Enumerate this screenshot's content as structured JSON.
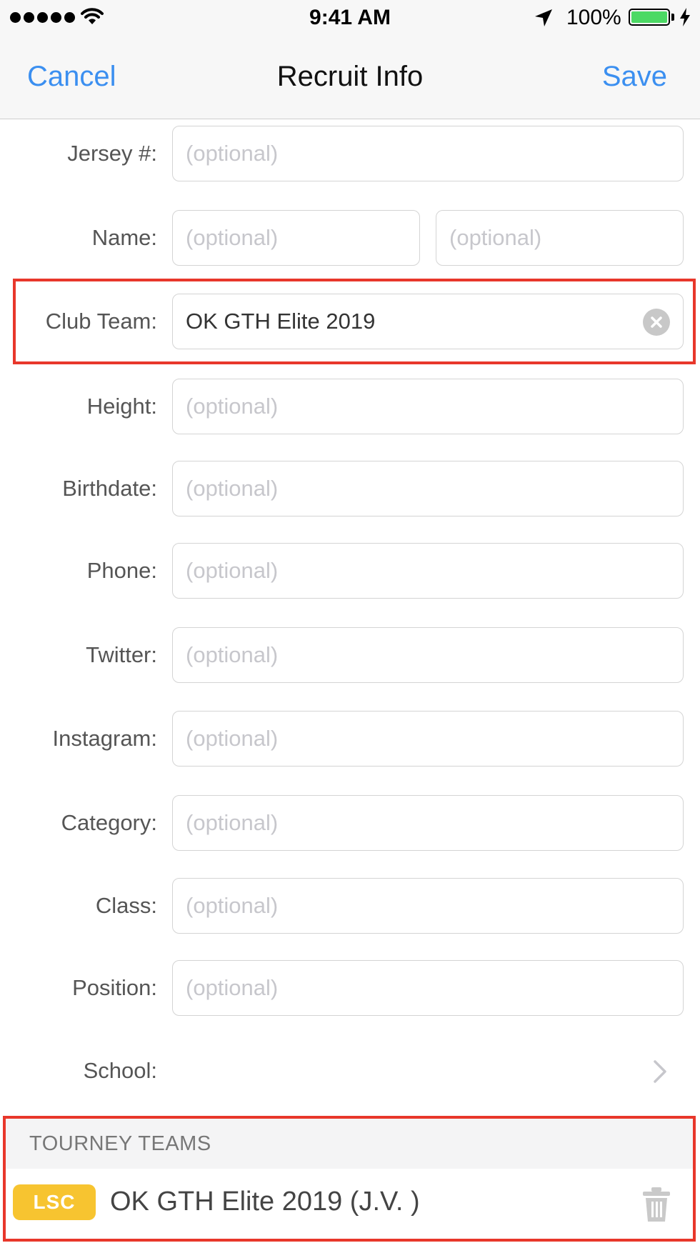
{
  "status_bar": {
    "time": "9:41 AM",
    "battery_percent": "100%",
    "signal_bars": 5,
    "icons": [
      "signal-dots-icon",
      "wifi-icon",
      "location-arrow-icon",
      "battery-icon",
      "charging-bolt-icon"
    ]
  },
  "nav": {
    "cancel_label": "Cancel",
    "title": "Recruit Info",
    "save_label": "Save",
    "accent_color": "#3b8ff0"
  },
  "form": {
    "jersey": {
      "label": "Jersey #:",
      "placeholder": "(optional)",
      "value": ""
    },
    "name": {
      "label": "Name:",
      "first_placeholder": "(optional)",
      "last_placeholder": "(optional)",
      "first_value": "",
      "last_value": ""
    },
    "club_team": {
      "label": "Club Team:",
      "value": "OK GTH Elite 2019",
      "clear_icon": "clear-circle-icon"
    },
    "height": {
      "label": "Height:",
      "placeholder": "(optional)",
      "value": ""
    },
    "birthdate": {
      "label": "Birthdate:",
      "placeholder": "(optional)",
      "value": ""
    },
    "phone": {
      "label": "Phone:",
      "placeholder": "(optional)",
      "value": ""
    },
    "twitter": {
      "label": "Twitter:",
      "placeholder": "(optional)",
      "value": ""
    },
    "instagram": {
      "label": "Instagram:",
      "placeholder": "(optional)",
      "value": ""
    },
    "category": {
      "label": "Category:",
      "placeholder": "(optional)",
      "value": ""
    },
    "class": {
      "label": "Class:",
      "placeholder": "(optional)",
      "value": ""
    },
    "position": {
      "label": "Position:",
      "placeholder": "(optional)",
      "value": ""
    },
    "school": {
      "label": "School:",
      "icon": "chevron-right-icon"
    }
  },
  "tourney_teams": {
    "header": "TOURNEY TEAMS",
    "items": [
      {
        "badge": "LSC",
        "badge_color": "#f7c430",
        "name": "OK GTH Elite 2019 (J.V. )",
        "delete_icon": "trash-icon"
      }
    ]
  },
  "highlight_color": "#e8372b"
}
